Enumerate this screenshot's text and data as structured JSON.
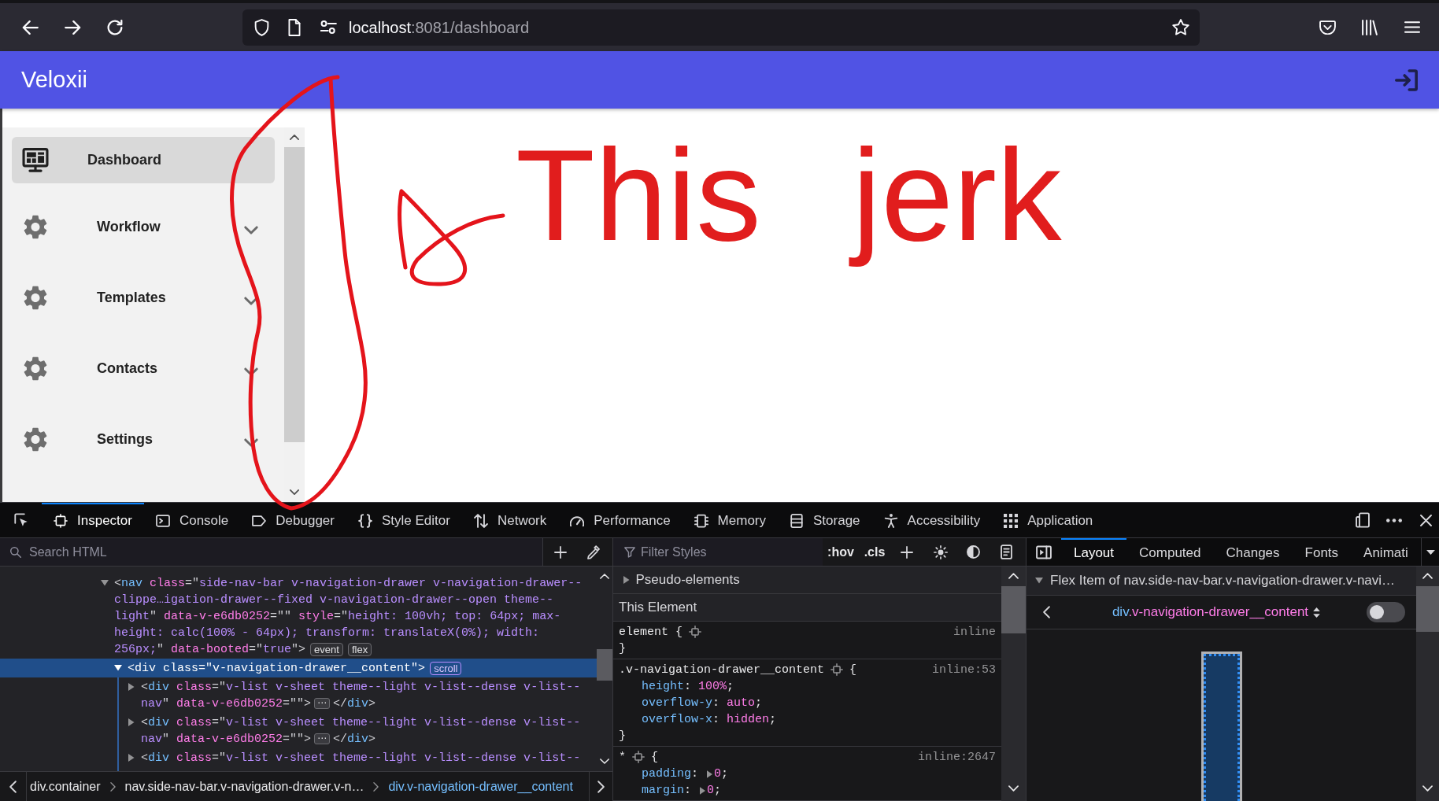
{
  "browser": {
    "address": {
      "host": "localhost",
      "path": ":8081/dashboard"
    }
  },
  "app": {
    "title": "Veloxii"
  },
  "sidebar": {
    "items": [
      {
        "kind": "link",
        "label": "Dashboard",
        "selected": true
      },
      {
        "kind": "group",
        "label": "Workflow",
        "selected": false,
        "expanded": false
      },
      {
        "kind": "group",
        "label": "Templates",
        "selected": false,
        "expanded": false
      },
      {
        "kind": "group",
        "label": "Contacts",
        "selected": false,
        "expanded": false
      },
      {
        "kind": "group",
        "label": "Settings",
        "selected": false,
        "expanded": false
      }
    ]
  },
  "annotation": {
    "text": "This jerk"
  },
  "devtools": {
    "tools": [
      {
        "label": "Inspector",
        "selected": true
      },
      {
        "label": "Console",
        "selected": false
      },
      {
        "label": "Debugger",
        "selected": false
      },
      {
        "label": "Style Editor",
        "selected": false
      },
      {
        "label": "Network",
        "selected": false
      },
      {
        "label": "Performance",
        "selected": false
      },
      {
        "label": "Memory",
        "selected": false
      },
      {
        "label": "Storage",
        "selected": false
      },
      {
        "label": "Accessibility",
        "selected": false
      },
      {
        "label": "Application",
        "selected": false
      }
    ],
    "markup": {
      "search": {
        "placeholder": "Search HTML"
      },
      "nodes": [
        {
          "expanded": true,
          "selected": false,
          "lines": [
            [
              {
                "kind": "punct",
                "text": "<"
              },
              {
                "kind": "tag",
                "text": "nav"
              },
              {
                "kind": "attr",
                "text": " class"
              },
              {
                "kind": "punct",
                "text": "=\""
              },
              {
                "kind": "value",
                "text": "side-nav-bar v-navigation-drawer v-navigation-drawer--"
              }
            ],
            [
              {
                "kind": "value",
                "text": "clippe…igation-drawer--fixed v-navigation-drawer--open theme--"
              }
            ],
            [
              {
                "kind": "value",
                "text": "light"
              },
              {
                "kind": "punct",
                "text": "\" "
              },
              {
                "kind": "attr",
                "text": "data-v-e6db0252"
              },
              {
                "kind": "punct",
                "text": "=\"\" "
              },
              {
                "kind": "attr",
                "text": "style"
              },
              {
                "kind": "punct",
                "text": "=\""
              },
              {
                "kind": "value",
                "text": "height: 100vh; top: 64px; max-"
              }
            ],
            [
              {
                "kind": "value",
                "text": "height: calc(100% - 64px); transform: translateX(0%); width:"
              }
            ],
            [
              {
                "kind": "value",
                "text": "256px;"
              },
              {
                "kind": "punct",
                "text": "\" "
              },
              {
                "kind": "attr",
                "text": "data-booted"
              },
              {
                "kind": "punct",
                "text": "=\""
              },
              {
                "kind": "value",
                "text": "true"
              },
              {
                "kind": "punct",
                "text": "\">"
              },
              {
                "kind": "badge",
                "text": "event"
              },
              {
                "kind": "badge",
                "text": "flex"
              }
            ]
          ],
          "children": [
            {
              "expanded": true,
              "selected": true,
              "lines": [
                [
                  {
                    "kind": "punct",
                    "text": "<"
                  },
                  {
                    "kind": "tag",
                    "text": "div"
                  },
                  {
                    "kind": "attr",
                    "text": " class"
                  },
                  {
                    "kind": "punct",
                    "text": "=\""
                  },
                  {
                    "kind": "value",
                    "text": "v-navigation-drawer__content"
                  },
                  {
                    "kind": "punct",
                    "text": "\">"
                  },
                  {
                    "kind": "badge",
                    "text": "scroll"
                  }
                ]
              ],
              "children": [
                {
                  "expanded": false,
                  "selected": false,
                  "lines": [
                    [
                      {
                        "kind": "punct",
                        "text": "<"
                      },
                      {
                        "kind": "tag",
                        "text": "div"
                      },
                      {
                        "kind": "attr",
                        "text": " class"
                      },
                      {
                        "kind": "punct",
                        "text": "=\""
                      },
                      {
                        "kind": "value",
                        "text": "v-list v-sheet theme--light v-list--dense v-list--"
                      }
                    ],
                    [
                      {
                        "kind": "value",
                        "text": "nav"
                      },
                      {
                        "kind": "punct",
                        "text": "\" "
                      },
                      {
                        "kind": "attr",
                        "text": "data-v-e6db0252"
                      },
                      {
                        "kind": "punct",
                        "text": "=\"\">"
                      },
                      {
                        "kind": "more",
                        "text": "⋯"
                      },
                      {
                        "kind": "punct",
                        "text": "</"
                      },
                      {
                        "kind": "tag",
                        "text": "div"
                      },
                      {
                        "kind": "punct",
                        "text": ">"
                      }
                    ]
                  ]
                },
                {
                  "expanded": false,
                  "selected": false,
                  "lines": [
                    [
                      {
                        "kind": "punct",
                        "text": "<"
                      },
                      {
                        "kind": "tag",
                        "text": "div"
                      },
                      {
                        "kind": "attr",
                        "text": " class"
                      },
                      {
                        "kind": "punct",
                        "text": "=\""
                      },
                      {
                        "kind": "value",
                        "text": "v-list v-sheet theme--light v-list--dense v-list--"
                      }
                    ],
                    [
                      {
                        "kind": "value",
                        "text": "nav"
                      },
                      {
                        "kind": "punct",
                        "text": "\" "
                      },
                      {
                        "kind": "attr",
                        "text": "data-v-e6db0252"
                      },
                      {
                        "kind": "punct",
                        "text": "=\"\">"
                      },
                      {
                        "kind": "more",
                        "text": "⋯"
                      },
                      {
                        "kind": "punct",
                        "text": "</"
                      },
                      {
                        "kind": "tag",
                        "text": "div"
                      },
                      {
                        "kind": "punct",
                        "text": ">"
                      }
                    ]
                  ]
                },
                {
                  "expanded": false,
                  "selected": false,
                  "lines": [
                    [
                      {
                        "kind": "punct",
                        "text": "<"
                      },
                      {
                        "kind": "tag",
                        "text": "div"
                      },
                      {
                        "kind": "attr",
                        "text": " class"
                      },
                      {
                        "kind": "punct",
                        "text": "=\""
                      },
                      {
                        "kind": "value",
                        "text": "v-list v-sheet theme--light v-list--dense v-list--"
                      }
                    ]
                  ]
                }
              ]
            }
          ]
        }
      ],
      "breadcrumbs": [
        {
          "label": "div.container",
          "selected": false
        },
        {
          "label": "nav.side-nav-bar.v-navigation-drawer.v-n…",
          "selected": false
        },
        {
          "label": "div.v-navigation-drawer__content",
          "selected": true
        }
      ]
    },
    "rules": {
      "filter": {
        "placeholder": "Filter Styles"
      },
      "toggles": [
        ":hov",
        ".cls"
      ],
      "sections": [
        {
          "kind": "section",
          "label": "Pseudo-elements",
          "expanded": false
        },
        {
          "kind": "header",
          "label": "This Element"
        },
        {
          "kind": "rule",
          "selector": [
            {
              "kind": "selector",
              "text": "element"
            },
            {
              "kind": "punct",
              "text": " {"
            },
            {
              "kind": "icon"
            }
          ],
          "source": "inline",
          "close": "}"
        },
        {
          "kind": "rule",
          "selector": [
            {
              "kind": "selector",
              "text": ".v-navigation-drawer__content"
            },
            {
              "kind": "icon"
            },
            {
              "kind": "punct",
              "text": "{"
            }
          ],
          "source": "inline:53",
          "declarations": [
            [
              {
                "kind": "property",
                "text": "height"
              },
              {
                "kind": "punct",
                "text": ": "
              },
              {
                "kind": "value",
                "text": "100%"
              },
              {
                "kind": "punct",
                "text": ";"
              }
            ],
            [
              {
                "kind": "property",
                "text": "overflow-y"
              },
              {
                "kind": "punct",
                "text": ": "
              },
              {
                "kind": "value",
                "text": "auto"
              },
              {
                "kind": "punct",
                "text": ";"
              }
            ],
            [
              {
                "kind": "property",
                "text": "overflow-x"
              },
              {
                "kind": "punct",
                "text": ": "
              },
              {
                "kind": "value",
                "text": "hidden"
              },
              {
                "kind": "punct",
                "text": ";"
              }
            ]
          ],
          "close": "}"
        },
        {
          "kind": "rule",
          "selector": [
            {
              "kind": "selector",
              "text": "*"
            },
            {
              "kind": "icon"
            },
            {
              "kind": "punct",
              "text": "{"
            }
          ],
          "source": "inline:2647",
          "declarations": [
            [
              {
                "kind": "property",
                "text": "padding"
              },
              {
                "kind": "punct",
                "text": ": "
              },
              {
                "kind": "expander",
                "expanded": false
              },
              {
                "kind": "value",
                "text": "0"
              },
              {
                "kind": "punct",
                "text": ";"
              }
            ],
            [
              {
                "kind": "property",
                "text": "margin"
              },
              {
                "kind": "punct",
                "text": ": "
              },
              {
                "kind": "expander",
                "expanded": false
              },
              {
                "kind": "value",
                "text": "0"
              },
              {
                "kind": "punct",
                "text": ";"
              }
            ]
          ]
        }
      ]
    },
    "sidebar": {
      "tabs": [
        {
          "label": "Layout",
          "selected": true
        },
        {
          "label": "Computed",
          "selected": false
        },
        {
          "label": "Changes",
          "selected": false
        },
        {
          "label": "Fonts",
          "selected": false
        },
        {
          "label": "Animati",
          "selected": false
        }
      ],
      "flex_item": {
        "title": "Flex Item of nav.side-nav-bar.v-navigation-drawer.v-navi…",
        "expanded": true,
        "element": {
          "tag": "div",
          "classes": ".v-navigation-drawer__content"
        },
        "highlight": {
          "on": false
        }
      }
    }
  }
}
